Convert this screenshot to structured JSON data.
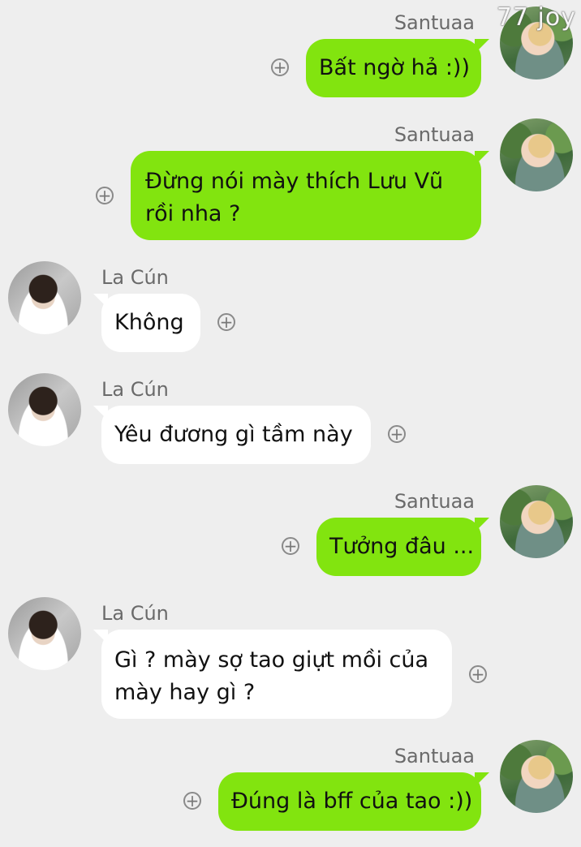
{
  "watermark": "77 joy",
  "messages": [
    {
      "sender": "Santuaa",
      "text": "Bất ngờ hả :))",
      "side": "right"
    },
    {
      "sender": "Santuaa",
      "line1": "Đừng nói mày thích Lưu Vũ",
      "line2": "rồi nha ?",
      "side": "right"
    },
    {
      "sender": "La Cún",
      "text": "Không",
      "side": "left"
    },
    {
      "sender": "La Cún",
      "text": "Yêu đương gì tầm này",
      "side": "left"
    },
    {
      "sender": "Santuaa",
      "text": "Tưởng đâu ...",
      "side": "right"
    },
    {
      "sender": "La Cún",
      "line1": "Gì ? mày sợ tao giựt mồi của",
      "line2": "mày hay gì ?",
      "side": "left"
    },
    {
      "sender": "Santuaa",
      "text": "Đúng là bff của tao :))",
      "side": "right"
    }
  ],
  "icons": {
    "add": "plus-circle-icon"
  }
}
